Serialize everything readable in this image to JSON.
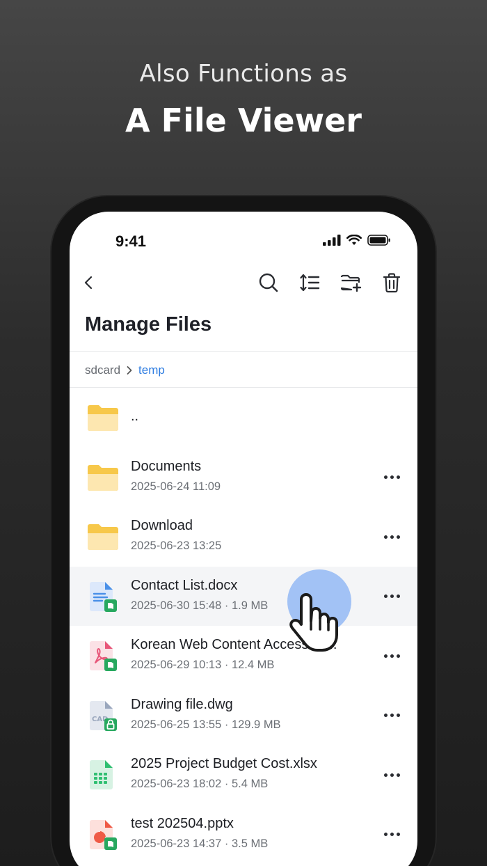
{
  "promo": {
    "subtitle": "Also Functions as",
    "title": "A File Viewer"
  },
  "status_bar": {
    "time": "9:41",
    "icons": [
      "signal-icon",
      "wifi-icon",
      "battery-icon"
    ]
  },
  "toolbar": {
    "back": "back-icon",
    "actions": [
      "search-icon",
      "sort-icon",
      "new-folder-icon",
      "delete-icon"
    ]
  },
  "page": {
    "title": "Manage Files"
  },
  "breadcrumb": {
    "root": "sdcard",
    "current": "temp"
  },
  "files": [
    {
      "name": "..",
      "meta": "",
      "type": "folder"
    },
    {
      "name": "Documents",
      "meta": "2025-06-24 11:09",
      "type": "folder"
    },
    {
      "name": "Download",
      "meta": "2025-06-23 13:25",
      "type": "folder"
    },
    {
      "name": "Contact List.docx",
      "meta": "2025-06-30 15:48 · 1.9 MB",
      "type": "docx",
      "highlighted": true
    },
    {
      "name": "Korean Web Content Accessibil...",
      "meta": "2025-06-29 10:13 · 12.4 MB",
      "type": "pdf"
    },
    {
      "name": "Drawing file.dwg",
      "meta": "2025-06-25 13:55 · 129.9 MB",
      "type": "dwg",
      "icon_label": "CAD"
    },
    {
      "name": "2025 Project Budget Cost.xlsx",
      "meta": "2025-06-23 18:02 · 5.4 MB",
      "type": "xlsx"
    },
    {
      "name": "test 202504.pptx",
      "meta": "2025-06-23 14:37 · 3.5 MB",
      "type": "pptx"
    }
  ],
  "colors": {
    "accent": "#2f7de1",
    "folder": "#f7c84a",
    "touch": "#93b8f5"
  }
}
